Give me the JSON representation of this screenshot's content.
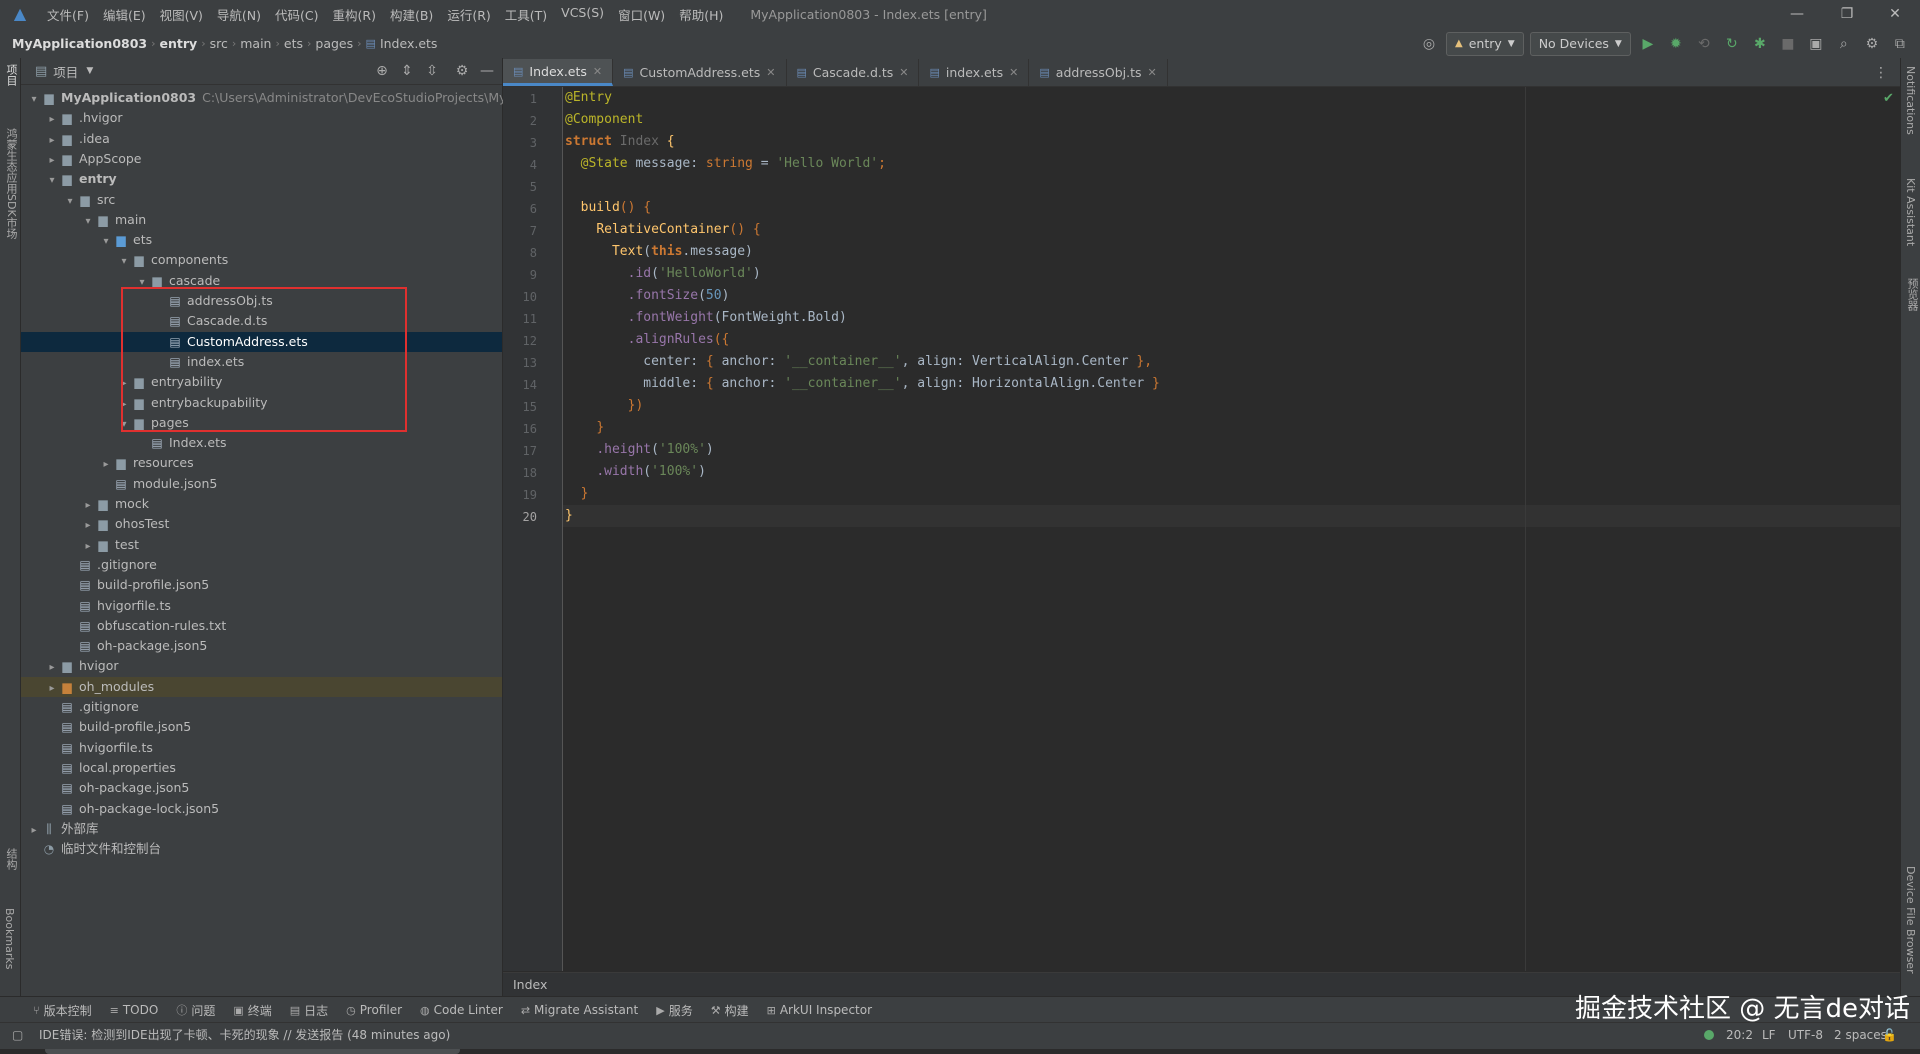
{
  "menubar": {
    "items": [
      "文件(F)",
      "编辑(E)",
      "视图(V)",
      "导航(N)",
      "代码(C)",
      "重构(R)",
      "构建(B)",
      "运行(R)",
      "工具(T)",
      "VCS(S)",
      "窗口(W)",
      "帮助(H)"
    ],
    "window_title": "MyApplication0803 - Index.ets [entry]"
  },
  "navbar": {
    "breadcrumbs": [
      "MyApplication0803",
      "entry",
      "src",
      "main",
      "ets",
      "pages",
      "Index.ets"
    ],
    "run_config": "entry",
    "device": "No Devices"
  },
  "left_stripe": {
    "top_label": "项目",
    "sdk_label": "鸿蒙生态应用SDK市场",
    "structure_label": "结构",
    "bookmarks_label": "Bookmarks"
  },
  "right_stripe": {
    "notifications": "Notifications",
    "kit_assistant": "Kit Assistant",
    "previewer": "预览器",
    "device_file_browser": "Device File Browser"
  },
  "project_panel": {
    "title": "项目",
    "tree": [
      {
        "label": "MyApplication0803",
        "hint": "C:\\Users\\Administrator\\DevEcoStudioProjects\\MyApp",
        "depth": 0,
        "arrow": "down",
        "kind": "folder",
        "bold": true
      },
      {
        "label": ".hvigor",
        "depth": 1,
        "arrow": "right",
        "kind": "folder"
      },
      {
        "label": ".idea",
        "depth": 1,
        "arrow": "right",
        "kind": "folder"
      },
      {
        "label": "AppScope",
        "depth": 1,
        "arrow": "right",
        "kind": "folder"
      },
      {
        "label": "entry",
        "depth": 1,
        "arrow": "down",
        "kind": "folder",
        "bold": true
      },
      {
        "label": "src",
        "depth": 2,
        "arrow": "down",
        "kind": "folder"
      },
      {
        "label": "main",
        "depth": 3,
        "arrow": "down",
        "kind": "folder"
      },
      {
        "label": "ets",
        "depth": 4,
        "arrow": "down",
        "kind": "folder-blue"
      },
      {
        "label": "components",
        "depth": 5,
        "arrow": "down",
        "kind": "folder"
      },
      {
        "label": "cascade",
        "depth": 6,
        "arrow": "down",
        "kind": "folder"
      },
      {
        "label": "addressObj.ts",
        "depth": 7,
        "arrow": "",
        "kind": "file"
      },
      {
        "label": "Cascade.d.ts",
        "depth": 7,
        "arrow": "",
        "kind": "file"
      },
      {
        "label": "CustomAddress.ets",
        "depth": 7,
        "arrow": "",
        "kind": "file",
        "selected": true
      },
      {
        "label": "index.ets",
        "depth": 7,
        "arrow": "",
        "kind": "file"
      },
      {
        "label": "entryability",
        "depth": 5,
        "arrow": "right",
        "kind": "folder"
      },
      {
        "label": "entrybackupability",
        "depth": 5,
        "arrow": "right",
        "kind": "folder"
      },
      {
        "label": "pages",
        "depth": 5,
        "arrow": "down",
        "kind": "folder"
      },
      {
        "label": "Index.ets",
        "depth": 6,
        "arrow": "",
        "kind": "file"
      },
      {
        "label": "resources",
        "depth": 4,
        "arrow": "right",
        "kind": "folder"
      },
      {
        "label": "module.json5",
        "depth": 4,
        "arrow": "",
        "kind": "file"
      },
      {
        "label": "mock",
        "depth": 3,
        "arrow": "right",
        "kind": "folder"
      },
      {
        "label": "ohosTest",
        "depth": 3,
        "arrow": "right",
        "kind": "folder"
      },
      {
        "label": "test",
        "depth": 3,
        "arrow": "right",
        "kind": "folder"
      },
      {
        "label": ".gitignore",
        "depth": 2,
        "arrow": "",
        "kind": "file"
      },
      {
        "label": "build-profile.json5",
        "depth": 2,
        "arrow": "",
        "kind": "file"
      },
      {
        "label": "hvigorfile.ts",
        "depth": 2,
        "arrow": "",
        "kind": "file"
      },
      {
        "label": "obfuscation-rules.txt",
        "depth": 2,
        "arrow": "",
        "kind": "file"
      },
      {
        "label": "oh-package.json5",
        "depth": 2,
        "arrow": "",
        "kind": "file"
      },
      {
        "label": "hvigor",
        "depth": 1,
        "arrow": "right",
        "kind": "folder"
      },
      {
        "label": "oh_modules",
        "depth": 1,
        "arrow": "right",
        "kind": "folder-orange",
        "excluded": true
      },
      {
        "label": ".gitignore",
        "depth": 1,
        "arrow": "",
        "kind": "file"
      },
      {
        "label": "build-profile.json5",
        "depth": 1,
        "arrow": "",
        "kind": "file"
      },
      {
        "label": "hvigorfile.ts",
        "depth": 1,
        "arrow": "",
        "kind": "file"
      },
      {
        "label": "local.properties",
        "depth": 1,
        "arrow": "",
        "kind": "file"
      },
      {
        "label": "oh-package.json5",
        "depth": 1,
        "arrow": "",
        "kind": "file"
      },
      {
        "label": "oh-package-lock.json5",
        "depth": 1,
        "arrow": "",
        "kind": "file"
      },
      {
        "label": "外部库",
        "depth": 0,
        "arrow": "right",
        "kind": "lib"
      },
      {
        "label": "临时文件和控制台",
        "depth": 0,
        "arrow": "",
        "kind": "scratch"
      }
    ]
  },
  "editor": {
    "tabs": [
      {
        "label": "Index.ets",
        "active": true
      },
      {
        "label": "CustomAddress.ets",
        "active": false
      },
      {
        "label": "Cascade.d.ts",
        "active": false
      },
      {
        "label": "index.ets",
        "active": false
      },
      {
        "label": "addressObj.ts",
        "active": false
      }
    ],
    "line_numbers": [
      "1",
      "2",
      "3",
      "4",
      "5",
      "6",
      "7",
      "8",
      "9",
      "10",
      "11",
      "12",
      "13",
      "14",
      "15",
      "16",
      "17",
      "18",
      "19",
      "20"
    ],
    "code_lines": [
      [
        {
          "t": "@Entry",
          "c": "ann"
        }
      ],
      [
        {
          "t": "@Component",
          "c": "ann"
        }
      ],
      [
        {
          "t": "struct ",
          "c": "kwb"
        },
        {
          "t": "Index ",
          "c": "tyn"
        },
        {
          "t": "{",
          "c": "fn"
        }
      ],
      [
        {
          "t": "  "
        },
        {
          "t": "@State ",
          "c": "ann"
        },
        {
          "t": "message",
          "c": "plain"
        },
        {
          "t": ": ",
          "c": "plain"
        },
        {
          "t": "string",
          "c": "kw"
        },
        {
          "t": " = ",
          "c": "plain"
        },
        {
          "t": "'Hello World'",
          "c": "str"
        },
        {
          "t": ";",
          "c": "kw"
        }
      ],
      [
        {
          "t": ""
        }
      ],
      [
        {
          "t": "  "
        },
        {
          "t": "build",
          "c": "fn"
        },
        {
          "t": "() {",
          "c": "kw"
        }
      ],
      [
        {
          "t": "    "
        },
        {
          "t": "RelativeContainer",
          "c": "fn"
        },
        {
          "t": "() {",
          "c": "kw"
        }
      ],
      [
        {
          "t": "      "
        },
        {
          "t": "Text",
          "c": "fn"
        },
        {
          "t": "(",
          "c": "plain"
        },
        {
          "t": "this",
          "c": "kwb"
        },
        {
          "t": ".message)",
          "c": "plain"
        }
      ],
      [
        {
          "t": "        "
        },
        {
          "t": ".id",
          "c": "mth"
        },
        {
          "t": "(",
          "c": "plain"
        },
        {
          "t": "'HelloWorld'",
          "c": "str"
        },
        {
          "t": ")",
          "c": "plain"
        }
      ],
      [
        {
          "t": "        "
        },
        {
          "t": ".fontSize",
          "c": "mth"
        },
        {
          "t": "(",
          "c": "plain"
        },
        {
          "t": "50",
          "c": "num"
        },
        {
          "t": ")",
          "c": "plain"
        }
      ],
      [
        {
          "t": "        "
        },
        {
          "t": ".fontWeight",
          "c": "mth"
        },
        {
          "t": "(FontWeight.Bold)",
          "c": "plain"
        }
      ],
      [
        {
          "t": "        "
        },
        {
          "t": ".alignRules",
          "c": "mth"
        },
        {
          "t": "({",
          "c": "kw"
        }
      ],
      [
        {
          "t": "          "
        },
        {
          "t": "center: ",
          "c": "plain"
        },
        {
          "t": "{ ",
          "c": "kw"
        },
        {
          "t": "anchor: ",
          "c": "plain"
        },
        {
          "t": "'__container__'",
          "c": "str"
        },
        {
          "t": ", align: VerticalAlign.Center ",
          "c": "plain"
        },
        {
          "t": "},",
          "c": "kw"
        }
      ],
      [
        {
          "t": "          "
        },
        {
          "t": "middle: ",
          "c": "plain"
        },
        {
          "t": "{ ",
          "c": "kw"
        },
        {
          "t": "anchor: ",
          "c": "plain"
        },
        {
          "t": "'__container__'",
          "c": "str"
        },
        {
          "t": ", align: HorizontalAlign.Center ",
          "c": "plain"
        },
        {
          "t": "}",
          "c": "kw"
        }
      ],
      [
        {
          "t": "        "
        },
        {
          "t": "})",
          "c": "kw"
        }
      ],
      [
        {
          "t": "    "
        },
        {
          "t": "}",
          "c": "kw"
        }
      ],
      [
        {
          "t": "    "
        },
        {
          "t": ".height",
          "c": "mth"
        },
        {
          "t": "(",
          "c": "plain"
        },
        {
          "t": "'100%'",
          "c": "str"
        },
        {
          "t": ")",
          "c": "plain"
        }
      ],
      [
        {
          "t": "    "
        },
        {
          "t": ".width",
          "c": "mth"
        },
        {
          "t": "(",
          "c": "plain"
        },
        {
          "t": "'100%'",
          "c": "str"
        },
        {
          "t": ")",
          "c": "plain"
        }
      ],
      [
        {
          "t": "  "
        },
        {
          "t": "}",
          "c": "kw"
        }
      ],
      [
        {
          "t": "}",
          "c": "fn"
        }
      ]
    ],
    "current_line": "20",
    "breadcrumb": "Index"
  },
  "tool_windows": [
    {
      "label": "版本控制",
      "icon": "branch-icon"
    },
    {
      "label": "TODO",
      "icon": "list-icon"
    },
    {
      "label": "问题",
      "icon": "info-icon"
    },
    {
      "label": "终端",
      "icon": "terminal-icon"
    },
    {
      "label": "日志",
      "icon": "log-icon"
    },
    {
      "label": "Profiler",
      "icon": "profiler-icon"
    },
    {
      "label": "Code Linter",
      "icon": "linter-icon"
    },
    {
      "label": "Migrate Assistant",
      "icon": "migrate-icon"
    },
    {
      "label": "服务",
      "icon": "services-icon"
    },
    {
      "label": "构建",
      "icon": "hammer-icon"
    },
    {
      "label": "ArkUI Inspector",
      "icon": "inspector-icon"
    }
  ],
  "status": {
    "message": "IDE错误: 检测到IDE出现了卡顿、卡死的现象 // 发送报告 (48 minutes ago)",
    "position": "20:2",
    "line_ending": "LF",
    "encoding": "UTF-8",
    "indent": "2 spaces"
  },
  "watermark": "掘金技术社区 @ 无言de对话",
  "colors": {
    "accent": "#4a88c7",
    "selection": "#0d293e",
    "highlight_box": "#e0302f"
  }
}
